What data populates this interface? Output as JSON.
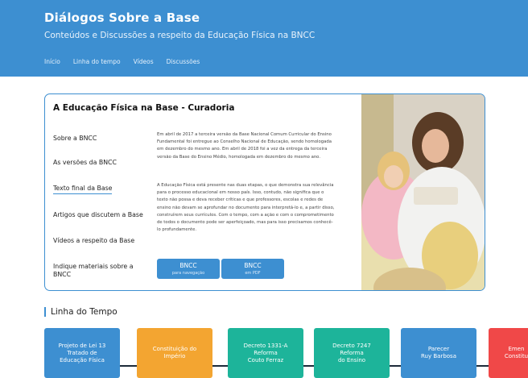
{
  "header": {
    "title": "Diálogos Sobre a Base",
    "subtitle": "Conteúdos e Discussões a respeito da Educação Física na BNCC",
    "nav": [
      "Início",
      "Linha do tempo",
      "Vídeos",
      "Discussões"
    ]
  },
  "card": {
    "title": "A Educação Física na Base - Curadoria",
    "sidebar": [
      "Sobre a BNCC",
      "As versões da BNCC",
      "Texto final da Base",
      "Artigos que discutem a Base",
      "Vídeos a respeito da Base",
      "Indique materiais sobre a BNCC"
    ],
    "paragraphs": [
      "Em abril de 2017 a terceira versão da Base Nacional Comum Curricular do Ensino Fundamental foi entregue ao Conselho Nacional de Educação, sendo homologada em dezembro do mesmo ano. Em abril de 2018 foi a vez da entrega da terceira versão da Base do Ensino Médio, homologada em dezembro do mesmo ano.",
      "A Educação Física está presente nas duas etapas, o que demonstra sua relevância para o processo educacional em nosso país. Isso, contudo, não significa que o texto não possa e deva receber críticas e que professores, escolas e redes de ensino não devam se aprofundar no documento para interpretá-lo e, a partir disso, construírem seus currículos. Com o tempo, com a ação e com o comprometimento de todos o documento pode ser aperfeiçoado, mas para isso precisamos conhecê-lo profundamente."
    ],
    "buttons": [
      {
        "label": "BNCC",
        "sub": "para navegação"
      },
      {
        "label": "BNCC",
        "sub": "em PDF"
      }
    ]
  },
  "timeline": {
    "title": "Linha do Tempo",
    "items": [
      {
        "text": "Projeto de Lei 13\nTratado de\nEducação Física",
        "color": "#3d8fd1"
      },
      {
        "text": "Constituição do\nImpério",
        "color": "#f3a531"
      },
      {
        "text": "Decreto 1331-A\nReforma\nCouto Ferraz",
        "color": "#1db49a"
      },
      {
        "text": "Decreto 7247\nReforma\ndo Ensino",
        "color": "#1db49a"
      },
      {
        "text": "Parecer\nRuy Barbosa",
        "color": "#3d8fd1"
      },
      {
        "text": "Emen\nConstitu",
        "color": "#f04848"
      }
    ]
  }
}
